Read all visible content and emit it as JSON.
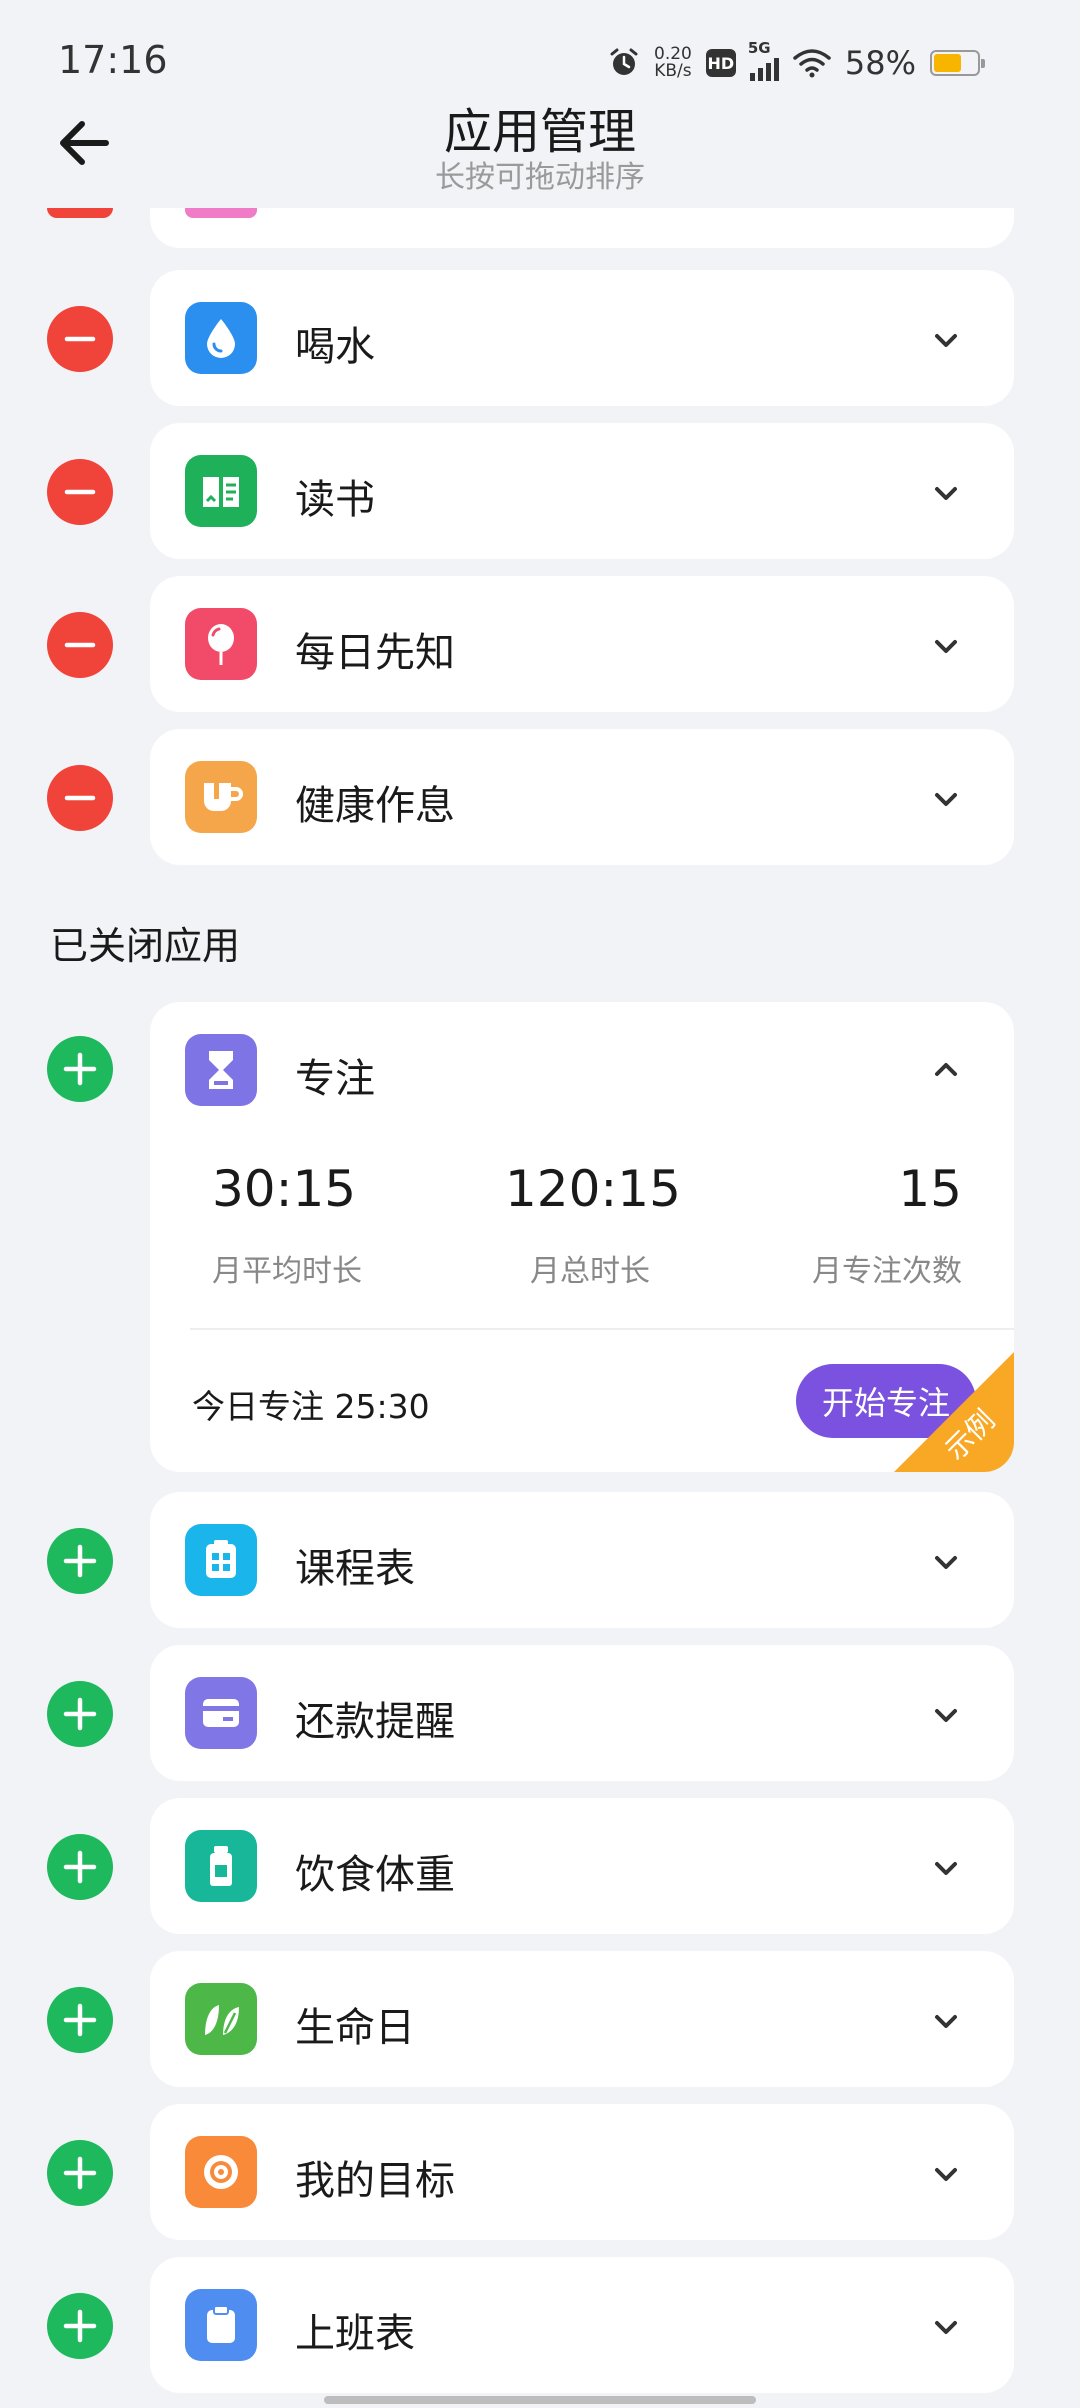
{
  "status_bar": {
    "time": "17:16",
    "net_speed_value": "0.20",
    "net_speed_unit": "KB/s",
    "hd": "HD",
    "network": "5G",
    "battery": "58%",
    "battery_level": 0.58,
    "battery_color": "#f7b500"
  },
  "header": {
    "title": "应用管理",
    "subtitle": "长按可拖动排序"
  },
  "enabled_apps": [
    {
      "label": "喝水",
      "icon": "water-drop-icon",
      "color": "#2b8ff0"
    },
    {
      "label": "读书",
      "icon": "book-icon",
      "color": "#1fb05a"
    },
    {
      "label": "每日先知",
      "icon": "balloon-icon",
      "color": "#f24b6a"
    },
    {
      "label": "健康作息",
      "icon": "cup-icon",
      "color": "#f6a64a"
    }
  ],
  "closed_section": {
    "title": "已关闭应用"
  },
  "focus_app": {
    "label": "专注",
    "icon": "hourglass-icon",
    "color": "#7f74e6",
    "stats": [
      {
        "value": "30:15",
        "label": "月平均时长"
      },
      {
        "value": "120:15",
        "label": "月总时长"
      },
      {
        "value": "15",
        "label": "月专注次数"
      }
    ],
    "today_text": "今日专注 25:30",
    "start_button": "开始专注",
    "corner_tag": "示例",
    "corner_color": "#f9a826",
    "button_color": "#7b52e0"
  },
  "closed_apps": [
    {
      "label": "课程表",
      "icon": "calendar-grid-icon",
      "color": "#1ab5ea"
    },
    {
      "label": "还款提醒",
      "icon": "card-icon",
      "color": "#8176e6"
    },
    {
      "label": "饮食体重",
      "icon": "bottle-icon",
      "color": "#18b79a"
    },
    {
      "label": "生命日",
      "icon": "leaf-icon",
      "color": "#4db848"
    },
    {
      "label": "我的目标",
      "icon": "target-icon",
      "color": "#f88a3a"
    },
    {
      "label": "上班表",
      "icon": "clipboard-icon",
      "color": "#4f8ef0"
    }
  ],
  "colors": {
    "remove": "#f0433a",
    "add": "#1db95c",
    "background": "#f2f3f7"
  }
}
